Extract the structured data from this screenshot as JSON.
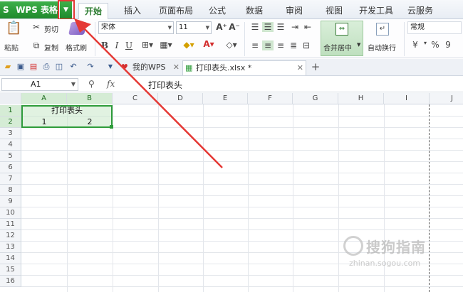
{
  "app": {
    "title": "WPS 表格",
    "logo": "S"
  },
  "menu": {
    "tabs": [
      "开始",
      "插入",
      "页面布局",
      "公式",
      "数据",
      "审阅",
      "视图",
      "开发工具",
      "云服务"
    ],
    "active": "开始"
  },
  "ribbon": {
    "paste": "粘贴",
    "cut": "剪切",
    "copy": "复制",
    "format_painter": "格式刷",
    "font_name": "宋体",
    "font_size": "11",
    "grow_font": "A⁺",
    "shrink_font": "A⁻",
    "bold": "B",
    "italic": "I",
    "underline": "U",
    "font_color_glyph": "A",
    "merge_center": "合并居中",
    "wrap_text": "自动换行",
    "number_format": "常规",
    "currency_symbol": "¥",
    "percent_symbol": "%",
    "thousands_symbol": "9"
  },
  "doc_tabs": [
    {
      "label": "我的WPS",
      "active": false
    },
    {
      "label": "打印表头.xlsx *",
      "active": true
    }
  ],
  "formula_bar": {
    "cell_ref": "A1",
    "fx": "fx",
    "content": "打印表头"
  },
  "sheet": {
    "columns": [
      "A",
      "B",
      "C",
      "D",
      "E",
      "F",
      "G",
      "H",
      "I",
      "J"
    ],
    "selected_columns": [
      "A",
      "B"
    ],
    "rows": [
      "1",
      "2",
      "3",
      "4",
      "5",
      "6",
      "7",
      "8",
      "9",
      "10",
      "11",
      "12",
      "13",
      "14",
      "15",
      "16"
    ],
    "selected_rows": [
      "1",
      "2"
    ],
    "cells": {
      "A1": "打印表头",
      "A2": "1",
      "B2": "2"
    }
  },
  "watermark": {
    "brand": "搜狗指南",
    "url": "zhinan.sogou.com"
  },
  "colors": {
    "accent_green": "#2e9c3a",
    "annotation_red": "#e53935",
    "selection_fill": "#c8e8c8"
  }
}
